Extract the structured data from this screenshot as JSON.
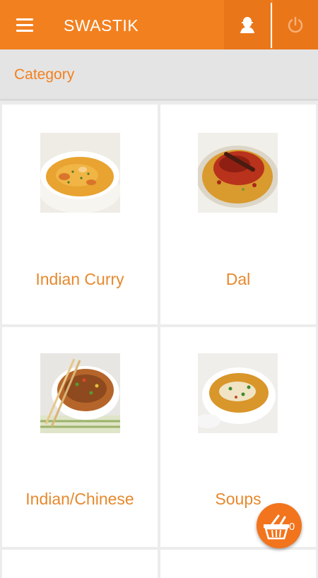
{
  "appbar": {
    "title": "SWASTIK",
    "menu_icon": "hamburger-menu-icon",
    "user_icon": "user-icon",
    "power_icon": "power-icon",
    "color": "#f2801f"
  },
  "subheader": {
    "title": "Category"
  },
  "categories": [
    {
      "label": "Indian Curry",
      "image": "bowl of orange curry"
    },
    {
      "label": "Dal",
      "image": "dal topped with red chili tadka"
    },
    {
      "label": "Indian/Chinese",
      "image": "hakka noodles bowl with chopsticks"
    },
    {
      "label": "Soups",
      "image": "bowl of soup with greens"
    }
  ],
  "cart": {
    "icon": "shopping-basket-icon",
    "count": "0"
  }
}
